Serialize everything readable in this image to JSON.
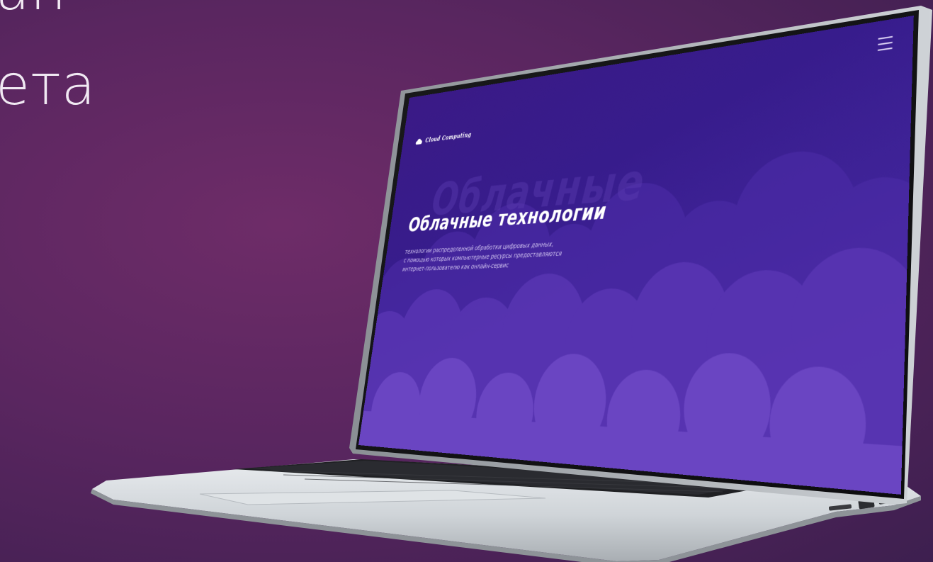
{
  "background": {
    "text_line1": "ан",
    "text_line2": "ета"
  },
  "site": {
    "logo": {
      "icon": "cloud-icon",
      "text": "Cloud Computing"
    },
    "menu": {
      "icon": "hamburger-menu-icon"
    },
    "watermark": "Облачные",
    "hero": {
      "title": "Облачные технологии",
      "description": [
        "технологии распределенной обработки цифровых данных,",
        "с помощью которых компьютерные ресурсы предоставляются",
        "интернет-пользователю как онлайн-сервис"
      ]
    }
  },
  "colors": {
    "page_bg": "#5a2660",
    "site_bg_top": "#3a1a86",
    "site_bg_bottom": "#5c36b3",
    "cloud_light": "#6a45c2",
    "text": "#ffffff"
  }
}
